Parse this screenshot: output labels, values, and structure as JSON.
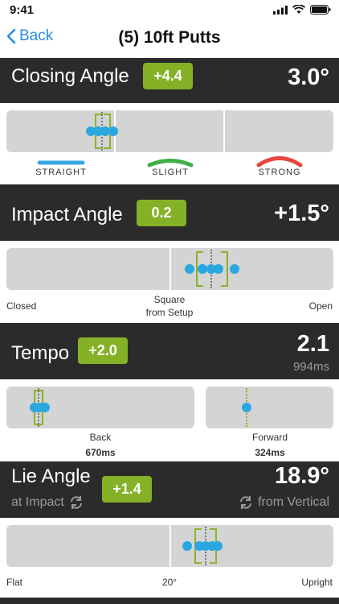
{
  "status_bar": {
    "time": "9:41"
  },
  "nav": {
    "back_label": "Back",
    "title": "(5) 10ft Putts"
  },
  "closing_angle": {
    "label": "Closing Angle",
    "delta": "+4.4",
    "value": "3.0°",
    "legend": [
      {
        "label": "STRAIGHT",
        "color": "#3aa8e4"
      },
      {
        "label": "SLIGHT",
        "color": "#3fae49"
      },
      {
        "label": "STRONG",
        "color": "#e8463e"
      }
    ]
  },
  "impact_angle": {
    "label": "Impact Angle",
    "delta": "0.2",
    "value": "+1.5°",
    "left_label": "Closed",
    "center_label_1": "Square",
    "center_label_2": "from Setup",
    "right_label": "Open"
  },
  "tempo": {
    "label": "Tempo",
    "delta": "+2.0",
    "value": "2.1",
    "total_ms": "994ms",
    "back_label": "Back",
    "back_ms": "670ms",
    "forward_label": "Forward",
    "forward_ms": "324ms"
  },
  "lie_angle": {
    "label": "Lie Angle",
    "sub_left": "at Impact",
    "delta": "+1.4",
    "value": "18.9°",
    "sub_right": "from Vertical",
    "left_label": "Flat",
    "center_label": "20°",
    "right_label": "Upright"
  },
  "colors": {
    "accent": "#85b126",
    "dot": "#2aa7e0",
    "link": "#2b8ce6",
    "header_bg": "#2b2b2b"
  },
  "icons": [
    "signal-icon",
    "wifi-icon",
    "battery-icon",
    "chevron-left-icon",
    "swap-icon"
  ]
}
